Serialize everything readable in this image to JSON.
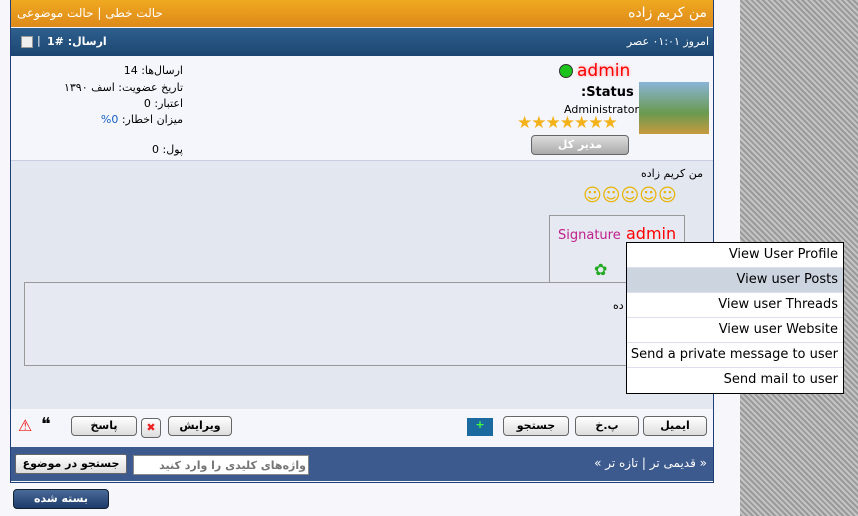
{
  "header": {
    "title": "من کریم زاده",
    "mode_threaded": "حالت موضوعی",
    "mode_linear": "حالت خطی",
    "sep": "|"
  },
  "postbar": {
    "date": "امروز ۰۱:۰۱ عصر",
    "post_number": "ارسال: #1",
    "sep": "|"
  },
  "user": {
    "name": "admin",
    "status": ":Status",
    "role": "Administrator",
    "stars": 7,
    "rank_badge": "مدیر کل",
    "online_color": "#1cc31c"
  },
  "stats": {
    "posts": "ارسال‌ها: 14",
    "joined": "تاریخ عضویت: اسف ۱۳۹۰",
    "reputation": "اعتبار: 0",
    "warning_label": "میزان اخطار:",
    "warning_value": "0%",
    "money": "پول: 0"
  },
  "post": {
    "text": "من کریم زاده",
    "smilies": 5,
    "signature_label": "Signature",
    "signature_name": "admin",
    "partial_text": "ده"
  },
  "menu": {
    "items": [
      "View User Profile",
      "View user Posts",
      "View user Threads",
      "View user Website",
      "Send a private message to user",
      "Send mail to user"
    ]
  },
  "buttons": {
    "email": "ایمیل",
    "pm": "پ.خ",
    "search": "جستجو",
    "edit": "ویرایش",
    "reply": "پاسخ"
  },
  "footer": {
    "nav": "« قدیمی تر | تازه تر »",
    "search_placeholder": "واژه‌های کلیدی را وارد کنید",
    "search_button": "جستجو در موضوع"
  },
  "closed": "بسته شده"
}
